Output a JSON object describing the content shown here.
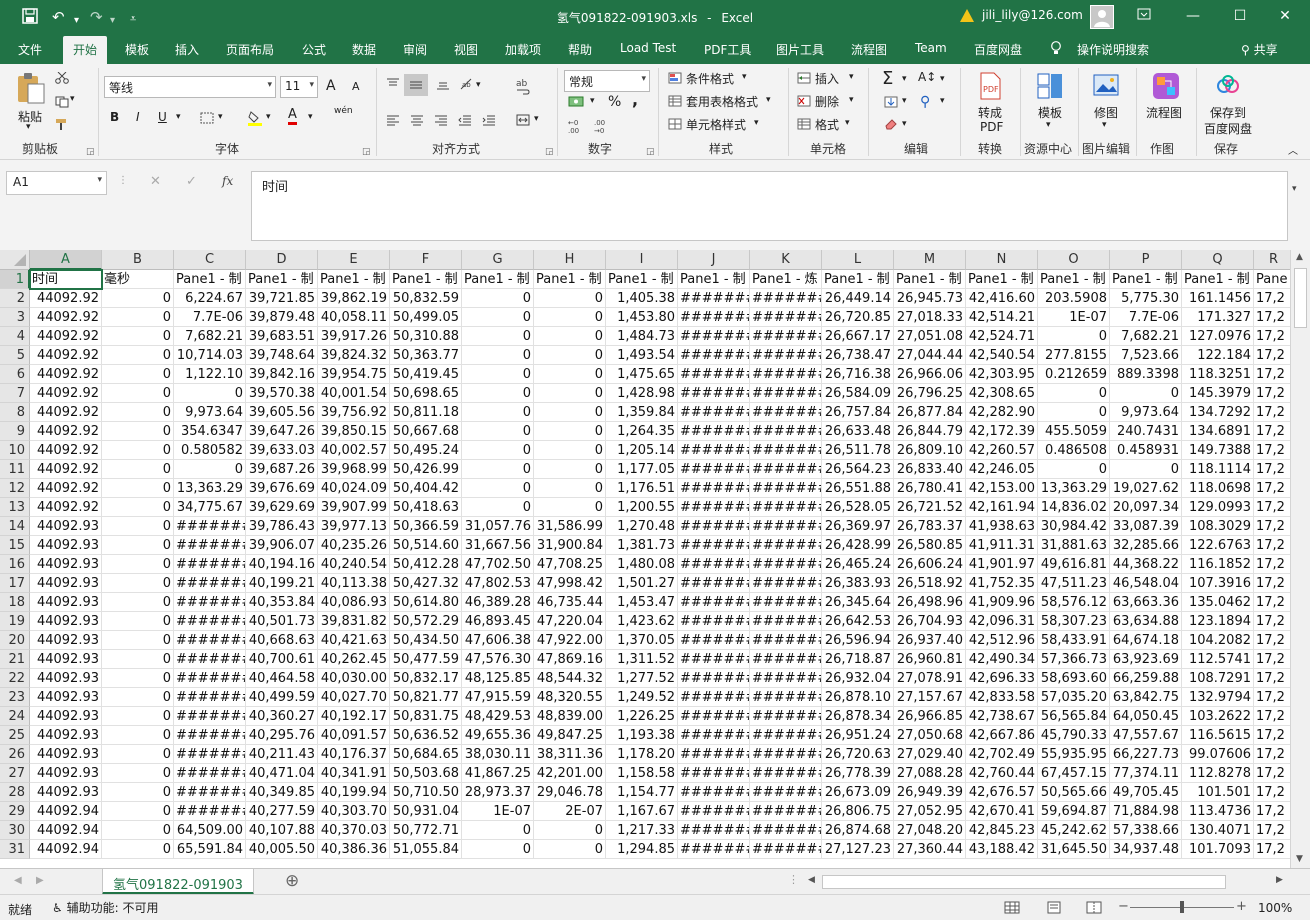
{
  "titlebar": {
    "filename": "氢气091822-091903.xls",
    "separator": "-",
    "app": "Excel",
    "user": "jili_lily@126.com"
  },
  "menu": {
    "items": [
      "文件",
      "开始",
      "模板",
      "插入",
      "页面布局",
      "公式",
      "数据",
      "审阅",
      "视图",
      "加载项",
      "帮助",
      "Load Test",
      "PDF工具",
      "图片工具",
      "流程图",
      "Team",
      "百度网盘"
    ],
    "active_index": 1,
    "search": "操作说明搜索",
    "share": "共享"
  },
  "ribbon": {
    "clipboard": {
      "paste": "粘贴",
      "group": "剪贴板"
    },
    "font": {
      "name": "等线",
      "size": "11",
      "group": "字体",
      "bold": "B",
      "italic": "I",
      "underline": "U",
      "grow": "A",
      "shrink": "A",
      "wen": "wén"
    },
    "align": {
      "group": "对齐方式"
    },
    "number": {
      "format": "常规",
      "group": "数字",
      "percent": "%",
      "comma": ","
    },
    "styles": {
      "cond": "条件格式",
      "table": "套用表格格式",
      "cell": "单元格样式",
      "group": "样式"
    },
    "cells": {
      "insert": "插入",
      "delete": "删除",
      "format": "格式",
      "group": "单元格"
    },
    "editing": {
      "group": "编辑"
    },
    "convert": {
      "btn1": "转成",
      "btn2": "PDF",
      "group": "转换"
    },
    "template": {
      "btn": "模板",
      "group": "资源中心"
    },
    "pic": {
      "btn": "修图",
      "group": "图片编辑"
    },
    "draw": {
      "btn": "流程图",
      "group": "作图"
    },
    "save": {
      "btn1": "保存到",
      "btn2": "百度网盘",
      "group": "保存"
    }
  },
  "formula_bar": {
    "name_box": "A1",
    "value": "时间",
    "fx": "fx"
  },
  "sheet": {
    "columns": [
      "A",
      "B",
      "C",
      "D",
      "E",
      "F",
      "G",
      "H",
      "I",
      "J",
      "K",
      "L",
      "M",
      "N",
      "O",
      "P",
      "Q",
      "R"
    ],
    "header_row": [
      "时间",
      "毫秒",
      "Pane1 - 制",
      "Pane1 - 制",
      "Pane1 - 制",
      "Pane1 - 制",
      "Pane1 - 制",
      "Pane1 - 制",
      "Pane1 - 制",
      "Pane1 - 制",
      "Pane1 - 炼",
      "Pane1 - 制",
      "Pane1 - 制",
      "Pane1 - 制",
      "Pane1 - 制",
      "Pane1 - 制",
      "Pane1 - 制",
      "Pane"
    ],
    "rows": [
      [
        "44092.92",
        "0",
        "6,224.67",
        "39,721.85",
        "39,862.19",
        "50,832.59",
        "0",
        "0",
        "1,405.38",
        "#######",
        "#######",
        "26,449.14",
        "26,945.73",
        "42,416.60",
        "203.5908",
        "5,775.30",
        "161.1456",
        "17,2"
      ],
      [
        "44092.92",
        "0",
        "7.7E-06",
        "39,879.48",
        "40,058.11",
        "50,499.05",
        "0",
        "0",
        "1,453.80",
        "#######",
        "#######",
        "26,720.85",
        "27,018.33",
        "42,514.21",
        "1E-07",
        "7.7E-06",
        "171.327",
        "17,2"
      ],
      [
        "44092.92",
        "0",
        "7,682.21",
        "39,683.51",
        "39,917.26",
        "50,310.88",
        "0",
        "0",
        "1,484.73",
        "#######",
        "#######",
        "26,667.17",
        "27,051.08",
        "42,524.71",
        "0",
        "7,682.21",
        "127.0976",
        "17,2"
      ],
      [
        "44092.92",
        "0",
        "10,714.03",
        "39,748.64",
        "39,824.32",
        "50,363.77",
        "0",
        "0",
        "1,493.54",
        "#######",
        "#######",
        "26,738.47",
        "27,044.44",
        "42,540.54",
        "277.8155",
        "7,523.66",
        "122.184",
        "17,2"
      ],
      [
        "44092.92",
        "0",
        "1,122.10",
        "39,842.16",
        "39,954.75",
        "50,419.45",
        "0",
        "0",
        "1,475.65",
        "#######",
        "#######",
        "26,716.38",
        "26,966.06",
        "42,303.95",
        "0.212659",
        "889.3398",
        "118.3251",
        "17,2"
      ],
      [
        "44092.92",
        "0",
        "0",
        "39,570.38",
        "40,001.54",
        "50,698.65",
        "0",
        "0",
        "1,428.98",
        "#######",
        "#######",
        "26,584.09",
        "26,796.25",
        "42,308.65",
        "0",
        "0",
        "145.3979",
        "17,2"
      ],
      [
        "44092.92",
        "0",
        "9,973.64",
        "39,605.56",
        "39,756.92",
        "50,811.18",
        "0",
        "0",
        "1,359.84",
        "#######",
        "#######",
        "26,757.84",
        "26,877.84",
        "42,282.90",
        "0",
        "9,973.64",
        "134.7292",
        "17,2"
      ],
      [
        "44092.92",
        "0",
        "354.6347",
        "39,647.26",
        "39,850.15",
        "50,667.68",
        "0",
        "0",
        "1,264.35",
        "#######",
        "#######",
        "26,633.48",
        "26,844.79",
        "42,172.39",
        "455.5059",
        "240.7431",
        "134.6891",
        "17,2"
      ],
      [
        "44092.92",
        "0",
        "0.580582",
        "39,633.03",
        "40,002.57",
        "50,495.24",
        "0",
        "0",
        "1,205.14",
        "#######",
        "#######",
        "26,511.78",
        "26,809.10",
        "42,260.57",
        "0.486508",
        "0.458931",
        "149.7388",
        "17,2"
      ],
      [
        "44092.92",
        "0",
        "0",
        "39,687.26",
        "39,968.99",
        "50,426.99",
        "0",
        "0",
        "1,177.05",
        "#######",
        "#######",
        "26,564.23",
        "26,833.40",
        "42,246.05",
        "0",
        "0",
        "118.1114",
        "17,2"
      ],
      [
        "44092.92",
        "0",
        "13,363.29",
        "39,676.69",
        "40,024.09",
        "50,404.42",
        "0",
        "0",
        "1,176.51",
        "#######",
        "#######",
        "26,551.88",
        "26,780.41",
        "42,153.00",
        "13,363.29",
        "19,027.62",
        "118.0698",
        "17,2"
      ],
      [
        "44092.92",
        "0",
        "34,775.67",
        "39,629.69",
        "39,907.99",
        "50,418.63",
        "0",
        "0",
        "1,200.55",
        "#######",
        "#######",
        "26,528.05",
        "26,721.52",
        "42,161.94",
        "14,836.02",
        "20,097.34",
        "129.0993",
        "17,2"
      ],
      [
        "44092.93",
        "0",
        "#######",
        "39,786.43",
        "39,977.13",
        "50,366.59",
        "31,057.76",
        "31,586.99",
        "1,270.48",
        "#######",
        "#######",
        "26,369.97",
        "26,783.37",
        "41,938.63",
        "30,984.42",
        "33,087.39",
        "108.3029",
        "17,2"
      ],
      [
        "44092.93",
        "0",
        "#######",
        "39,906.07",
        "40,235.26",
        "50,514.60",
        "31,667.56",
        "31,900.84",
        "1,381.73",
        "#######",
        "#######",
        "26,428.99",
        "26,580.85",
        "41,911.31",
        "31,881.63",
        "32,285.66",
        "122.6763",
        "17,2"
      ],
      [
        "44092.93",
        "0",
        "#######",
        "40,194.16",
        "40,240.54",
        "50,412.28",
        "47,702.50",
        "47,708.25",
        "1,480.08",
        "#######",
        "#######",
        "26,465.24",
        "26,606.24",
        "41,901.97",
        "49,616.81",
        "44,368.22",
        "116.1852",
        "17,2"
      ],
      [
        "44092.93",
        "0",
        "#######",
        "40,199.21",
        "40,113.38",
        "50,427.32",
        "47,802.53",
        "47,998.42",
        "1,501.27",
        "#######",
        "#######",
        "26,383.93",
        "26,518.92",
        "41,752.35",
        "47,511.23",
        "46,548.04",
        "107.3916",
        "17,2"
      ],
      [
        "44092.93",
        "0",
        "#######",
        "40,353.84",
        "40,086.93",
        "50,614.80",
        "46,389.28",
        "46,735.44",
        "1,453.47",
        "#######",
        "#######",
        "26,345.64",
        "26,498.96",
        "41,909.96",
        "58,576.12",
        "63,663.36",
        "135.0462",
        "17,2"
      ],
      [
        "44092.93",
        "0",
        "#######",
        "40,501.73",
        "39,831.82",
        "50,572.29",
        "46,893.45",
        "47,220.04",
        "1,423.62",
        "#######",
        "#######",
        "26,642.53",
        "26,704.93",
        "42,096.31",
        "58,307.23",
        "63,634.88",
        "123.1894",
        "17,2"
      ],
      [
        "44092.93",
        "0",
        "#######",
        "40,668.63",
        "40,421.63",
        "50,434.50",
        "47,606.38",
        "47,922.00",
        "1,370.05",
        "#######",
        "#######",
        "26,596.94",
        "26,937.40",
        "42,512.96",
        "58,433.91",
        "64,674.18",
        "104.2082",
        "17,2"
      ],
      [
        "44092.93",
        "0",
        "#######",
        "40,700.61",
        "40,262.45",
        "50,477.59",
        "47,576.30",
        "47,869.16",
        "1,311.52",
        "#######",
        "#######",
        "26,718.87",
        "26,960.81",
        "42,490.34",
        "57,366.73",
        "63,923.69",
        "112.5741",
        "17,2"
      ],
      [
        "44092.93",
        "0",
        "#######",
        "40,464.58",
        "40,030.00",
        "50,832.17",
        "48,125.85",
        "48,544.32",
        "1,277.52",
        "#######",
        "#######",
        "26,932.04",
        "27,078.91",
        "42,696.33",
        "58,693.60",
        "66,259.88",
        "108.7291",
        "17,2"
      ],
      [
        "44092.93",
        "0",
        "#######",
        "40,499.59",
        "40,027.70",
        "50,821.77",
        "47,915.59",
        "48,320.55",
        "1,249.52",
        "#######",
        "#######",
        "26,878.10",
        "27,157.67",
        "42,833.58",
        "57,035.20",
        "63,842.75",
        "132.9794",
        "17,2"
      ],
      [
        "44092.93",
        "0",
        "#######",
        "40,360.27",
        "40,192.17",
        "50,831.75",
        "48,429.53",
        "48,839.00",
        "1,226.25",
        "#######",
        "#######",
        "26,878.34",
        "26,966.85",
        "42,738.67",
        "56,565.84",
        "64,050.45",
        "103.2622",
        "17,2"
      ],
      [
        "44092.93",
        "0",
        "#######",
        "40,295.76",
        "40,091.57",
        "50,636.52",
        "49,655.36",
        "49,847.25",
        "1,193.38",
        "#######",
        "#######",
        "26,951.24",
        "27,050.68",
        "42,667.86",
        "45,790.33",
        "47,557.67",
        "116.5615",
        "17,2"
      ],
      [
        "44092.93",
        "0",
        "#######",
        "40,211.43",
        "40,176.37",
        "50,684.65",
        "38,030.11",
        "38,311.36",
        "1,178.20",
        "#######",
        "#######",
        "26,720.63",
        "27,029.40",
        "42,702.49",
        "55,935.95",
        "66,227.73",
        "99.07606",
        "17,2"
      ],
      [
        "44092.93",
        "0",
        "#######",
        "40,471.04",
        "40,341.91",
        "50,503.68",
        "41,867.25",
        "42,201.00",
        "1,158.58",
        "#######",
        "#######",
        "26,778.39",
        "27,088.28",
        "42,760.44",
        "67,457.15",
        "77,374.11",
        "112.8278",
        "17,2"
      ],
      [
        "44092.93",
        "0",
        "#######",
        "40,349.85",
        "40,199.94",
        "50,710.50",
        "28,973.37",
        "29,046.78",
        "1,154.77",
        "#######",
        "#######",
        "26,673.09",
        "26,949.39",
        "42,676.57",
        "50,565.66",
        "49,705.45",
        "101.501",
        "17,2"
      ],
      [
        "44092.94",
        "0",
        "#######",
        "40,277.59",
        "40,303.70",
        "50,931.04",
        "1E-07",
        "2E-07",
        "1,167.67",
        "#######",
        "#######",
        "26,806.75",
        "27,052.95",
        "42,670.41",
        "59,694.87",
        "71,884.98",
        "113.4736",
        "17,2"
      ],
      [
        "44092.94",
        "0",
        "64,509.00",
        "40,107.88",
        "40,370.03",
        "50,772.71",
        "0",
        "0",
        "1,217.33",
        "#######",
        "#######",
        "26,874.68",
        "27,048.20",
        "42,845.23",
        "45,242.62",
        "57,338.66",
        "130.4071",
        "17,2"
      ],
      [
        "44092.94",
        "0",
        "65,591.84",
        "40,005.50",
        "40,386.36",
        "51,055.84",
        "0",
        "0",
        "1,294.85",
        "#######",
        "#######",
        "27,127.23",
        "27,360.44",
        "43,188.42",
        "31,645.50",
        "34,937.48",
        "101.7093",
        "17,2"
      ]
    ],
    "tab": "氢气091822-091903"
  },
  "status": {
    "ready": "就绪",
    "accessibility": "辅助功能: 不可用",
    "zoom": "100%"
  }
}
